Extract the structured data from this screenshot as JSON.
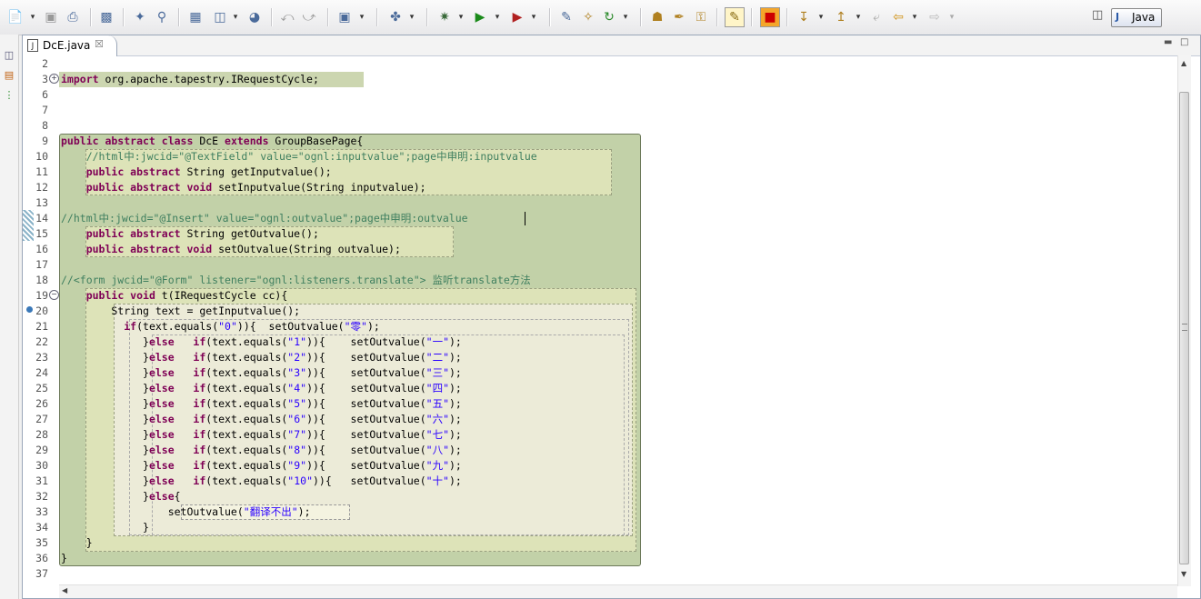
{
  "toolbar": {
    "icons": [
      "new-icon",
      "save-icon",
      "print-icon",
      "open-type-icon",
      "new-class-icon",
      "search-icon",
      "new-package-icon",
      "new-web-icon",
      "globe-icon",
      "undo-icon",
      "redo-icon",
      "camera-icon",
      "new-wizard-icon",
      "debug-icon",
      "run-icon",
      "run-external-icon",
      "new-file-icon",
      "new-folder-icon",
      "refresh-icon",
      "open-folder-icon",
      "pen-icon",
      "key-icon",
      "edit-mode-icon",
      "stop-icon",
      "next-annotation-icon",
      "prev-annotation-icon",
      "last-edit-icon",
      "back-icon",
      "forward-icon"
    ],
    "perspective_label": "Java"
  },
  "editor": {
    "tab_label": "DcE.java",
    "tab_icon": "J"
  },
  "lines": [
    {
      "n": "2",
      "segs": []
    },
    {
      "n": "3",
      "segs": [
        {
          "t": "import",
          "c": "kw"
        },
        {
          "t": " org.apache.tapestry.IRequestCycle;",
          "c": ""
        }
      ]
    },
    {
      "n": "6",
      "segs": []
    },
    {
      "n": "7",
      "segs": []
    },
    {
      "n": "8",
      "segs": []
    },
    {
      "n": "9",
      "segs": [
        {
          "t": "public abstract class",
          "c": "kw"
        },
        {
          "t": " DcE ",
          "c": ""
        },
        {
          "t": "extends",
          "c": "kw"
        },
        {
          "t": " GroupBasePage{",
          "c": ""
        }
      ]
    },
    {
      "n": "10",
      "segs": [
        {
          "t": "    //html中:jwcid=\"@TextField\" value=\"ognl:inputvalue\";page中申明:inputvalue",
          "c": "cm"
        }
      ]
    },
    {
      "n": "11",
      "segs": [
        {
          "t": "    ",
          "c": ""
        },
        {
          "t": "public abstract",
          "c": "kw"
        },
        {
          "t": " String getInputvalue();",
          "c": ""
        }
      ]
    },
    {
      "n": "12",
      "segs": [
        {
          "t": "    ",
          "c": ""
        },
        {
          "t": "public abstract void",
          "c": "kw"
        },
        {
          "t": " setInputvalue(String inputvalue);",
          "c": ""
        }
      ]
    },
    {
      "n": "13",
      "segs": []
    },
    {
      "n": "14",
      "segs": [
        {
          "t": "//html中:jwcid=\"@Insert\" value=\"ognl:outvalue\";page中申明:outvalue",
          "c": "cm"
        }
      ]
    },
    {
      "n": "15",
      "segs": [
        {
          "t": "    ",
          "c": ""
        },
        {
          "t": "public abstract",
          "c": "kw"
        },
        {
          "t": " String getOutvalue();",
          "c": ""
        }
      ]
    },
    {
      "n": "16",
      "segs": [
        {
          "t": "    ",
          "c": ""
        },
        {
          "t": "public abstract void",
          "c": "kw"
        },
        {
          "t": " setOutvalue(String outvalue);",
          "c": ""
        }
      ]
    },
    {
      "n": "17",
      "segs": []
    },
    {
      "n": "18",
      "segs": [
        {
          "t": "//<form jwcid=\"@Form\" listener=\"ognl:listeners.translate\"> 监听translate方法",
          "c": "cm"
        }
      ]
    },
    {
      "n": "19",
      "segs": [
        {
          "t": "    ",
          "c": ""
        },
        {
          "t": "public void",
          "c": "kw"
        },
        {
          "t": " t(IRequestCycle cc){",
          "c": ""
        }
      ]
    },
    {
      "n": "20",
      "segs": [
        {
          "t": "        String text = getInputvalue();",
          "c": ""
        }
      ]
    },
    {
      "n": "21",
      "segs": [
        {
          "t": "          ",
          "c": ""
        },
        {
          "t": "if",
          "c": "kw"
        },
        {
          "t": "(text.equals(",
          "c": ""
        },
        {
          "t": "\"0\"",
          "c": "str"
        },
        {
          "t": ")){  setOutvalue(",
          "c": ""
        },
        {
          "t": "\"零\"",
          "c": "str"
        },
        {
          "t": ");",
          "c": ""
        }
      ]
    },
    {
      "n": "22",
      "segs": [
        {
          "t": "             }",
          "c": ""
        },
        {
          "t": "else",
          "c": "kw"
        },
        {
          "t": "   ",
          "c": ""
        },
        {
          "t": "if",
          "c": "kw"
        },
        {
          "t": "(text.equals(",
          "c": ""
        },
        {
          "t": "\"1\"",
          "c": "str"
        },
        {
          "t": ")){    setOutvalue(",
          "c": ""
        },
        {
          "t": "\"一\"",
          "c": "str"
        },
        {
          "t": ");",
          "c": ""
        }
      ]
    },
    {
      "n": "23",
      "segs": [
        {
          "t": "             }",
          "c": ""
        },
        {
          "t": "else",
          "c": "kw"
        },
        {
          "t": "   ",
          "c": ""
        },
        {
          "t": "if",
          "c": "kw"
        },
        {
          "t": "(text.equals(",
          "c": ""
        },
        {
          "t": "\"2\"",
          "c": "str"
        },
        {
          "t": ")){    setOutvalue(",
          "c": ""
        },
        {
          "t": "\"二\"",
          "c": "str"
        },
        {
          "t": ");",
          "c": ""
        }
      ]
    },
    {
      "n": "24",
      "segs": [
        {
          "t": "             }",
          "c": ""
        },
        {
          "t": "else",
          "c": "kw"
        },
        {
          "t": "   ",
          "c": ""
        },
        {
          "t": "if",
          "c": "kw"
        },
        {
          "t": "(text.equals(",
          "c": ""
        },
        {
          "t": "\"3\"",
          "c": "str"
        },
        {
          "t": ")){    setOutvalue(",
          "c": ""
        },
        {
          "t": "\"三\"",
          "c": "str"
        },
        {
          "t": ");",
          "c": ""
        }
      ]
    },
    {
      "n": "25",
      "segs": [
        {
          "t": "             }",
          "c": ""
        },
        {
          "t": "else",
          "c": "kw"
        },
        {
          "t": "   ",
          "c": ""
        },
        {
          "t": "if",
          "c": "kw"
        },
        {
          "t": "(text.equals(",
          "c": ""
        },
        {
          "t": "\"4\"",
          "c": "str"
        },
        {
          "t": ")){    setOutvalue(",
          "c": ""
        },
        {
          "t": "\"四\"",
          "c": "str"
        },
        {
          "t": ");",
          "c": ""
        }
      ]
    },
    {
      "n": "26",
      "segs": [
        {
          "t": "             }",
          "c": ""
        },
        {
          "t": "else",
          "c": "kw"
        },
        {
          "t": "   ",
          "c": ""
        },
        {
          "t": "if",
          "c": "kw"
        },
        {
          "t": "(text.equals(",
          "c": ""
        },
        {
          "t": "\"5\"",
          "c": "str"
        },
        {
          "t": ")){    setOutvalue(",
          "c": ""
        },
        {
          "t": "\"五\"",
          "c": "str"
        },
        {
          "t": ");",
          "c": ""
        }
      ]
    },
    {
      "n": "27",
      "segs": [
        {
          "t": "             }",
          "c": ""
        },
        {
          "t": "else",
          "c": "kw"
        },
        {
          "t": "   ",
          "c": ""
        },
        {
          "t": "if",
          "c": "kw"
        },
        {
          "t": "(text.equals(",
          "c": ""
        },
        {
          "t": "\"6\"",
          "c": "str"
        },
        {
          "t": ")){    setOutvalue(",
          "c": ""
        },
        {
          "t": "\"六\"",
          "c": "str"
        },
        {
          "t": ");",
          "c": ""
        }
      ]
    },
    {
      "n": "28",
      "segs": [
        {
          "t": "             }",
          "c": ""
        },
        {
          "t": "else",
          "c": "kw"
        },
        {
          "t": "   ",
          "c": ""
        },
        {
          "t": "if",
          "c": "kw"
        },
        {
          "t": "(text.equals(",
          "c": ""
        },
        {
          "t": "\"7\"",
          "c": "str"
        },
        {
          "t": ")){    setOutvalue(",
          "c": ""
        },
        {
          "t": "\"七\"",
          "c": "str"
        },
        {
          "t": ");",
          "c": ""
        }
      ]
    },
    {
      "n": "29",
      "segs": [
        {
          "t": "             }",
          "c": ""
        },
        {
          "t": "else",
          "c": "kw"
        },
        {
          "t": "   ",
          "c": ""
        },
        {
          "t": "if",
          "c": "kw"
        },
        {
          "t": "(text.equals(",
          "c": ""
        },
        {
          "t": "\"8\"",
          "c": "str"
        },
        {
          "t": ")){    setOutvalue(",
          "c": ""
        },
        {
          "t": "\"八\"",
          "c": "str"
        },
        {
          "t": ");",
          "c": ""
        }
      ]
    },
    {
      "n": "30",
      "segs": [
        {
          "t": "             }",
          "c": ""
        },
        {
          "t": "else",
          "c": "kw"
        },
        {
          "t": "   ",
          "c": ""
        },
        {
          "t": "if",
          "c": "kw"
        },
        {
          "t": "(text.equals(",
          "c": ""
        },
        {
          "t": "\"9\"",
          "c": "str"
        },
        {
          "t": ")){    setOutvalue(",
          "c": ""
        },
        {
          "t": "\"九\"",
          "c": "str"
        },
        {
          "t": ");",
          "c": ""
        }
      ]
    },
    {
      "n": "31",
      "segs": [
        {
          "t": "             }",
          "c": ""
        },
        {
          "t": "else",
          "c": "kw"
        },
        {
          "t": "   ",
          "c": ""
        },
        {
          "t": "if",
          "c": "kw"
        },
        {
          "t": "(text.equals(",
          "c": ""
        },
        {
          "t": "\"10\"",
          "c": "str"
        },
        {
          "t": ")){   setOutvalue(",
          "c": ""
        },
        {
          "t": "\"十\"",
          "c": "str"
        },
        {
          "t": ");",
          "c": ""
        }
      ]
    },
    {
      "n": "32",
      "segs": [
        {
          "t": "             }",
          "c": ""
        },
        {
          "t": "else",
          "c": "kw"
        },
        {
          "t": "{",
          "c": ""
        }
      ]
    },
    {
      "n": "33",
      "segs": [
        {
          "t": "                 setOutvalue(",
          "c": ""
        },
        {
          "t": "\"翻译不出\"",
          "c": "str"
        },
        {
          "t": ");",
          "c": ""
        }
      ]
    },
    {
      "n": "34",
      "segs": [
        {
          "t": "             }",
          "c": ""
        }
      ]
    },
    {
      "n": "35",
      "segs": [
        {
          "t": "    }",
          "c": ""
        }
      ]
    },
    {
      "n": "36",
      "segs": [
        {
          "t": "}",
          "c": ""
        }
      ]
    },
    {
      "n": "37",
      "segs": []
    }
  ],
  "colors": {
    "keyword": "#7f0055",
    "comment": "#3f7f5f",
    "string": "#2a00ff",
    "block_outer": "#c2d1a8",
    "block_inner": "#dde3b8",
    "block_innermost": "#ecebd8",
    "import_highlight": "#ccd6b0"
  }
}
